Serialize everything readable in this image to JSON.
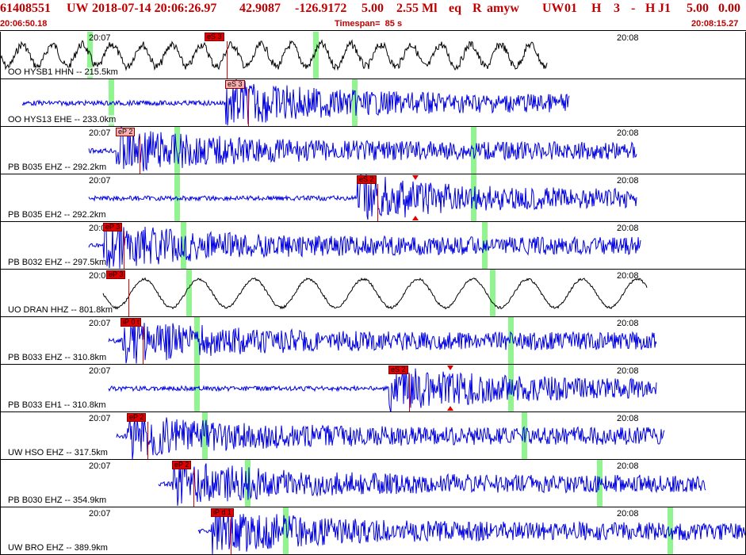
{
  "header": {
    "event_id": "61408551",
    "network": "UW",
    "datetime": "2018-07-14 20:06:26.97",
    "lat": "42.9087",
    "lon": "-126.9172",
    "depth": "5.00",
    "magnitude": "2.55 Ml",
    "etype": "eq",
    "review": "R",
    "author": "amyw",
    "net2": "UW",
    "code1": "01",
    "code2": "H",
    "code3": "3",
    "dash": "-",
    "code4": "H",
    "code5": "J1",
    "val1": "5.00",
    "val2": "0.00",
    "start_time": "20:06:50.18",
    "timespan": "Timespan=  85 s",
    "end_time": "20:08:15.27"
  },
  "colors": {
    "header": "#c00000",
    "trace_blue": "#0000e0",
    "trace_black": "#000000",
    "pick": "#e00000",
    "marker": "#6cf06c"
  },
  "panels": [
    {
      "station": "OO HYSB1 HHN -- 215.5km",
      "t1": "20:07",
      "t2": "20:08",
      "color": "black",
      "picks": [
        {
          "label": "eS 3",
          "light": false
        }
      ],
      "markers": 2,
      "tri": false
    },
    {
      "station": "OO HYS13 EHE -- 233.0km",
      "t1": "",
      "t2": "",
      "color": "blue",
      "picks": [
        {
          "label": "eS 3",
          "light": true
        }
      ],
      "markers": 2,
      "tri": false
    },
    {
      "station": "PB B035 EHZ -- 292.2km",
      "t1": "20:07",
      "t2": "20:08",
      "color": "blue",
      "picks": [
        {
          "label": "eP 2",
          "light": true
        }
      ],
      "markers": 2,
      "tri": false
    },
    {
      "station": "PB B035 EH2 -- 292.2km",
      "t1": "20:07",
      "t2": "20:08",
      "color": "blue",
      "picks": [
        {
          "label": "eS 2",
          "light": false
        }
      ],
      "markers": 2,
      "tri": true
    },
    {
      "station": "PB B032 EHZ -- 297.5km",
      "t1": "20:07",
      "t2": "20:08",
      "color": "blue",
      "picks": [
        {
          "label": "eP 3",
          "light": false
        }
      ],
      "markers": 2,
      "tri": false
    },
    {
      "station": "UO DRAN HHZ -- 801.8km",
      "t1": "20:07",
      "t2": "20:08",
      "color": "black",
      "picks": [
        {
          "label": "eP 3",
          "light": false
        }
      ],
      "markers": 2,
      "tri": false
    },
    {
      "station": "PB B033 EHZ -- 310.8km",
      "t1": "20:07",
      "t2": "20:08",
      "color": "blue",
      "picks": [
        {
          "label": "iP 0 t",
          "light": false
        }
      ],
      "markers": 2,
      "tri": false
    },
    {
      "station": "PB B033 EH1 -- 310.8km",
      "t1": "20:07",
      "t2": "20:08",
      "color": "blue",
      "picks": [
        {
          "label": "eS 2",
          "light": false
        }
      ],
      "markers": 2,
      "tri": true
    },
    {
      "station": "UW HSO EHZ -- 317.5km",
      "t1": "20:07",
      "t2": "20:08",
      "color": "blue",
      "picks": [
        {
          "label": "eP 2",
          "light": false
        }
      ],
      "markers": 2,
      "tri": false
    },
    {
      "station": "PB B030 EHZ -- 354.9km",
      "t1": "20:07",
      "t2": "20:08",
      "color": "blue",
      "picks": [
        {
          "label": "eP 2",
          "light": false
        }
      ],
      "markers": 2,
      "tri": false
    },
    {
      "station": "UW BRO EHZ -- 389.9km",
      "t1": "20:07",
      "t2": "20:08",
      "color": "blue",
      "picks": [
        {
          "label": "iP d 1",
          "light": false
        }
      ],
      "markers": 2,
      "tri": false
    }
  ]
}
